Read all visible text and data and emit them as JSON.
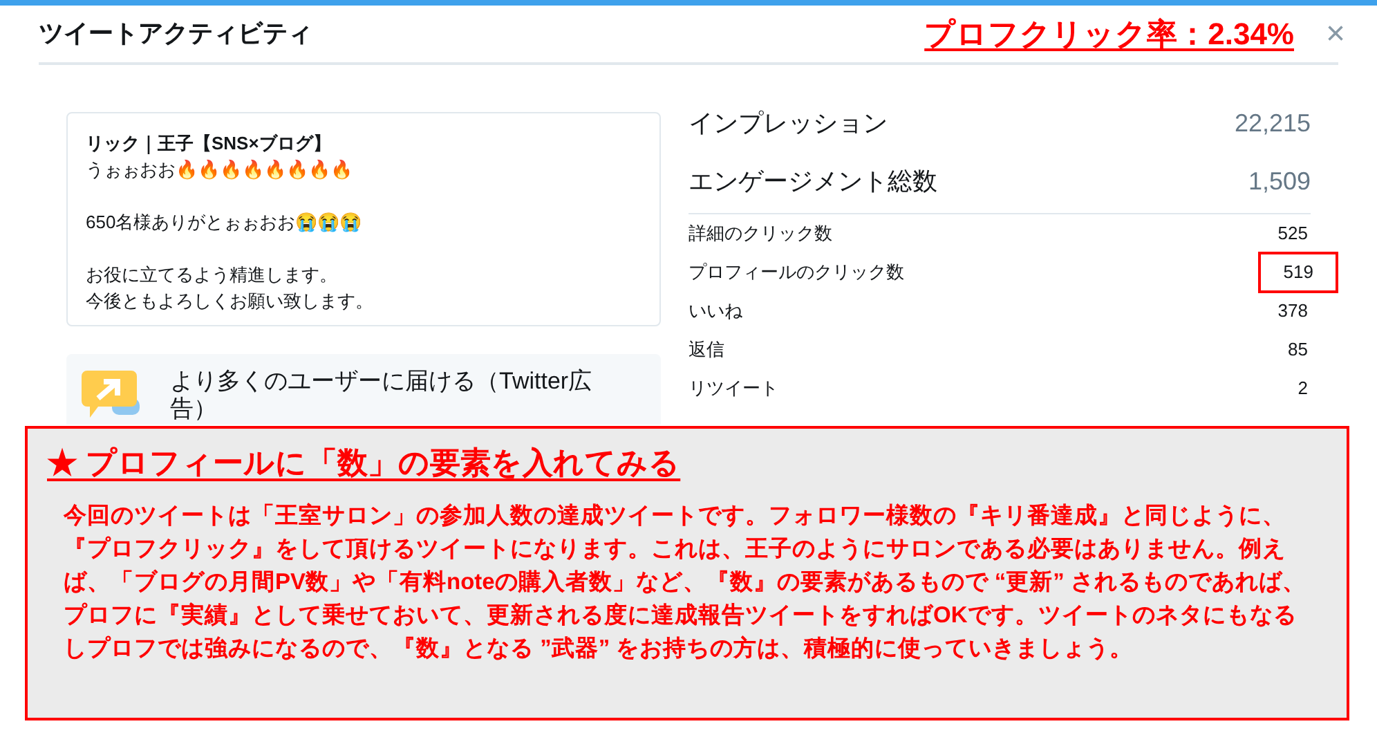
{
  "modal": {
    "title": "ツイートアクティビティ",
    "close": "×"
  },
  "overlay_caption": "プロフクリック率：2.34%",
  "tweet": {
    "author": "リック｜王子【SNS×ブログ】",
    "paragraphs": [
      [
        "うぉぉおお🔥🔥🔥🔥🔥🔥🔥🔥"
      ],
      [
        "650名様ありがとぉぉおお😭😭😭"
      ],
      [
        "お役に立てるよう精進します。",
        "今後ともよろしくお願い致します。"
      ]
    ]
  },
  "promote": {
    "label": "より多くのユーザーに届ける（Twitter広告）"
  },
  "metrics": [
    {
      "kind": "major",
      "label": "インプレッション",
      "value": "22,215"
    },
    {
      "kind": "major",
      "label": "エンゲージメント総数",
      "value": "1,509"
    },
    {
      "kind": "minor",
      "label": "詳細のクリック数",
      "value": "525",
      "highlighted": false
    },
    {
      "kind": "minor",
      "label": "プロフィールのクリック数",
      "value": "519",
      "highlighted": true
    },
    {
      "kind": "minor",
      "label": "いいね",
      "value": "378",
      "highlighted": false
    },
    {
      "kind": "minor",
      "label": "返信",
      "value": "85",
      "highlighted": false
    },
    {
      "kind": "minor",
      "label": "リツイート",
      "value": "2",
      "highlighted": false
    }
  ],
  "note": {
    "title": "★ プロフィールに「数」の要素を入れてみる",
    "body": "今回のツイートは「王室サロン」の参加人数の達成ツイートです。フォロワー様数の『キリ番達成』と同じように、『プロフクリック』をして頂けるツイートになります。これは、王子のようにサロンである必要はありません。例えば、「ブログの月間PV数」や「有料noteの購入者数」など、『数』の要素があるもので “更新” されるものであれば、プロフに『実績』として乗せておいて、更新される度に達成報告ツイートをすればOKです。ツイートのネタにもなるしプロフでは強みになるので、『数』となる ”武器” をお持ちの方は、積極的に使っていきましょう。"
  }
}
